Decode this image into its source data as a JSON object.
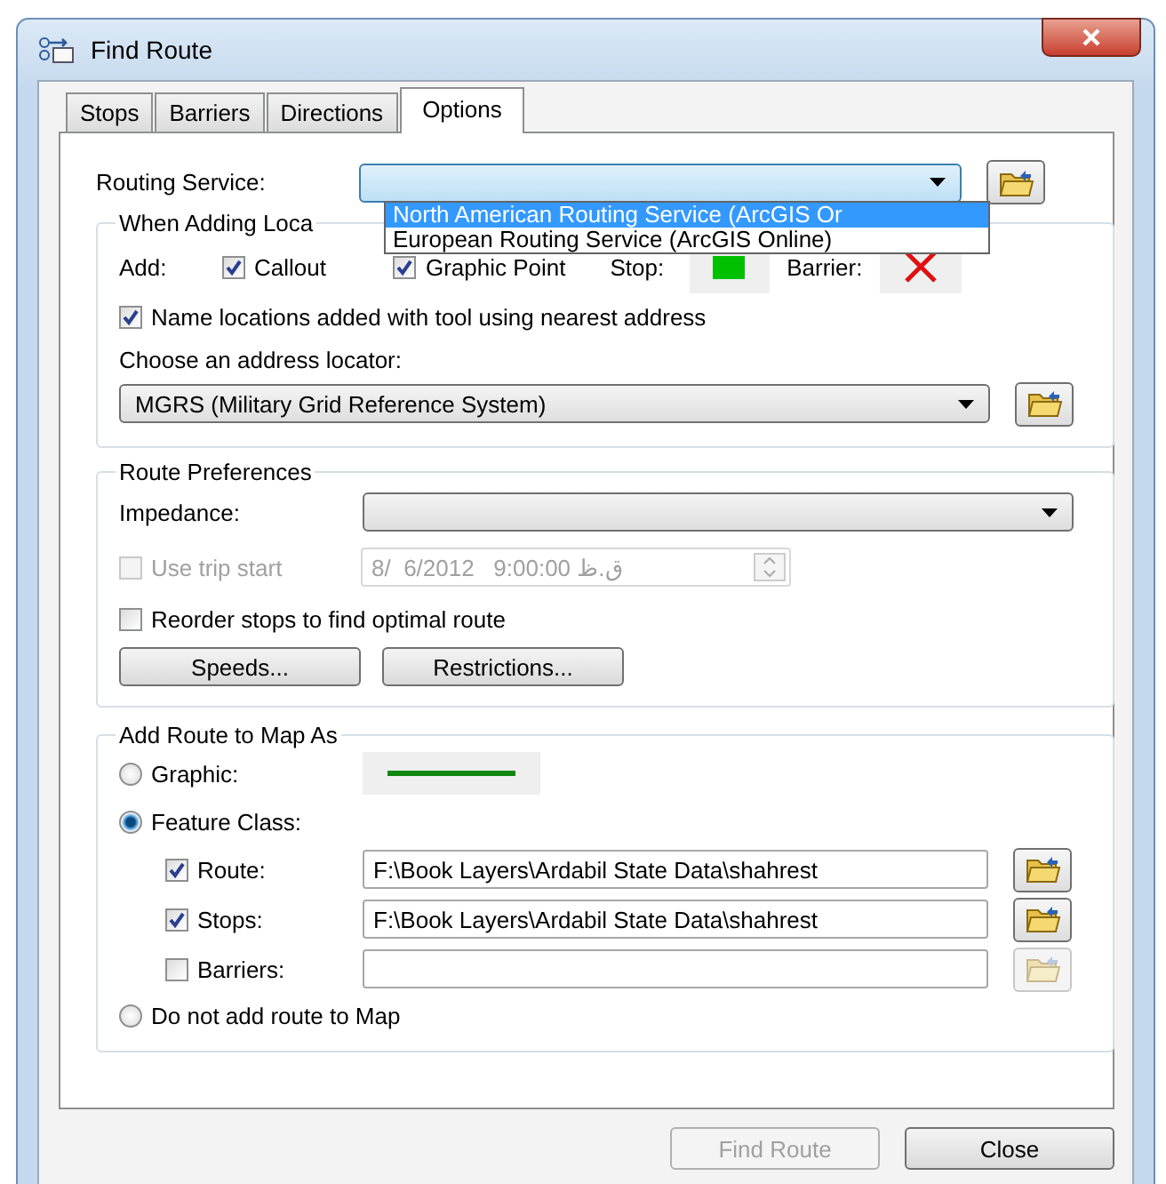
{
  "window": {
    "title": "Find Route"
  },
  "tabs": [
    {
      "label": "Stops",
      "selected": false
    },
    {
      "label": "Barriers",
      "selected": false
    },
    {
      "label": "Directions",
      "selected": false
    },
    {
      "label": "Options",
      "selected": true
    }
  ],
  "routing_service": {
    "label": "Routing Service:",
    "expanded": true,
    "options": [
      {
        "label": "North American Routing Service (ArcGIS Or",
        "selected": true
      },
      {
        "label": "European Routing Service (ArcGIS Online)",
        "selected": false
      }
    ]
  },
  "when_adding": {
    "legend": "When Adding Loca",
    "add_label": "Add:",
    "checkboxes": [
      {
        "label": "Callout",
        "checked": true
      },
      {
        "label": "Graphic Point",
        "checked": true
      }
    ],
    "stop_label": "Stop:",
    "barrier_label": "Barrier:",
    "name_locations": {
      "label": "Name locations added with tool using nearest address",
      "checked": true
    },
    "locator_label": "Choose an address locator:",
    "locator_value": "MGRS (Military Grid Reference System)"
  },
  "route_preferences": {
    "legend": "Route Preferences",
    "impedance_label": "Impedance:",
    "trip_start": {
      "label": "Use trip start",
      "checked": false,
      "disabled": true,
      "value": "8/  6/2012   9:00:00 ق.ظ"
    },
    "reorder": {
      "label": "Reorder stops to find optimal route",
      "checked": false
    },
    "buttons": [
      "Speeds...",
      "Restrictions..."
    ]
  },
  "add_route": {
    "legend": "Add Route to Map As",
    "options": [
      {
        "label": "Graphic:",
        "selected": false
      },
      {
        "label": "Feature Class:",
        "selected": true
      },
      {
        "label": "Do not add route to Map",
        "selected": false
      }
    ],
    "layers": [
      {
        "label": "Route:",
        "checked": true,
        "value": "F:\\Book Layers\\Ardabil State Data\\shahrest",
        "browse_disabled": false
      },
      {
        "label": "Stops:",
        "checked": true,
        "value": "F:\\Book Layers\\Ardabil State Data\\shahrest",
        "browse_disabled": false
      },
      {
        "label": "Barriers:",
        "checked": false,
        "browse_disabled": true
      }
    ]
  },
  "buttons": [
    {
      "label": "Find Route",
      "disabled": true
    },
    {
      "label": "Close",
      "disabled": false
    }
  ]
}
